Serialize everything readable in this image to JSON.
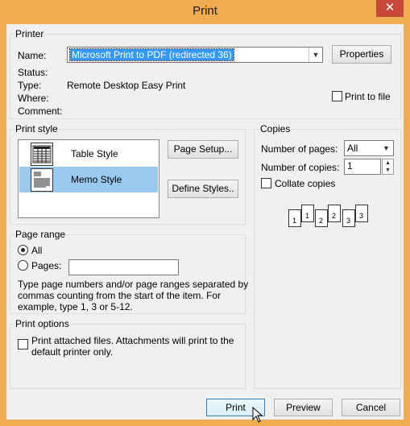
{
  "window": {
    "title": "Print",
    "close_glyph": "✕"
  },
  "printer": {
    "group_label": "Printer",
    "name_label": "Name:",
    "name_value": "Microsoft Print to PDF (redirected 36)",
    "properties_button": "Properties",
    "status_label": "Status:",
    "status_value": "",
    "type_label": "Type:",
    "type_value": "Remote Desktop Easy Print",
    "where_label": "Where:",
    "where_value": "",
    "comment_label": "Comment:",
    "comment_value": "",
    "print_to_file_label": "Print to file"
  },
  "print_style": {
    "group_label": "Print style",
    "items": [
      {
        "label": "Table Style",
        "selected": false,
        "icon": "table-style-icon"
      },
      {
        "label": "Memo Style",
        "selected": true,
        "icon": "memo-style-icon"
      }
    ],
    "page_setup_button": "Page Setup...",
    "define_styles_button": "Define Styles.."
  },
  "copies": {
    "group_label": "Copies",
    "number_of_pages_label": "Number of pages:",
    "number_of_pages_value": "All",
    "number_of_copies_label": "Number of copies:",
    "number_of_copies_value": "1",
    "collate_label": "Collate copies",
    "collate_checked": false,
    "collate_pages": [
      [
        "1",
        "1"
      ],
      [
        "2",
        "2"
      ],
      [
        "3",
        "3"
      ]
    ]
  },
  "page_range": {
    "group_label": "Page range",
    "all_label": "All",
    "pages_label": "Pages:",
    "pages_value": "",
    "help_lines": [
      "Type page numbers and/or page ranges separated by",
      "commas counting from the start of the item.  For",
      "example, type 1, 3 or 5-12."
    ]
  },
  "print_options": {
    "group_label": "Print options",
    "attached_lines": [
      "Print attached files.  Attachments will print to the",
      "default printer only."
    ]
  },
  "footer": {
    "print_button": "Print",
    "preview_button": "Preview",
    "cancel_button": "Cancel"
  },
  "colors": {
    "title_bar": "#f0ac50",
    "selection": "#3399ff",
    "list_selection": "#99c9ef",
    "close_button": "#c7473a"
  }
}
